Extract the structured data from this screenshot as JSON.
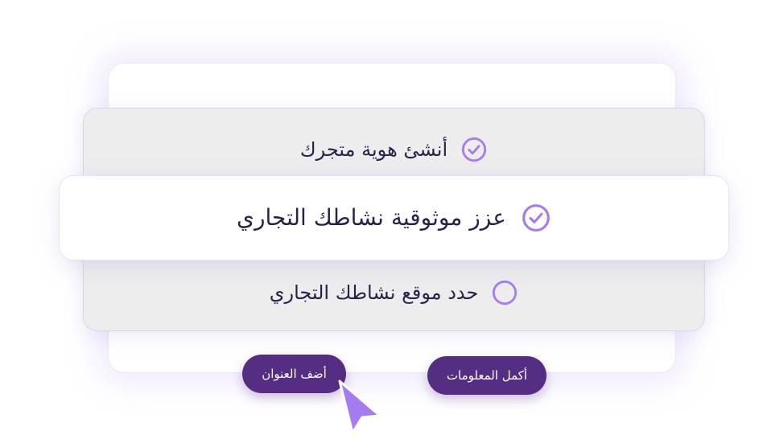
{
  "steps": [
    {
      "label": "أنشئ هوية متجرك",
      "status": "done",
      "icon": "check-circle-icon"
    },
    {
      "label": "عزز موثوقية نشاطك التجاري",
      "status": "done",
      "icon": "check-circle-icon"
    },
    {
      "label": "حدد موقع نشاطك التجاري",
      "status": "pending",
      "icon": "empty-circle-icon"
    }
  ],
  "buttons": {
    "add_address": "أضف العنوان",
    "complete_info": "أكمل المعلومات"
  },
  "colors": {
    "accent": "#a57cf0",
    "button": "#552d82",
    "text": "#2c1f4a",
    "panel": "#ededed"
  }
}
